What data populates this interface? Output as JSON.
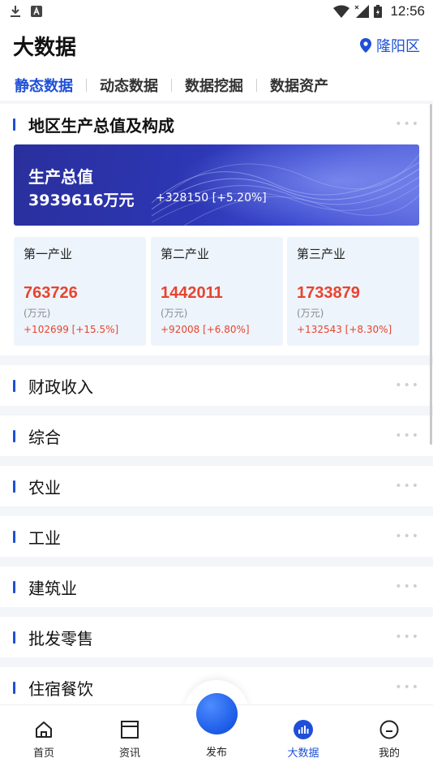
{
  "status_bar": {
    "time": "12:56"
  },
  "header": {
    "title": "大数据",
    "location": "隆阳区"
  },
  "tabs": [
    {
      "label": "静态数据",
      "active": true
    },
    {
      "label": "动态数据",
      "active": false
    },
    {
      "label": "数据挖掘",
      "active": false
    },
    {
      "label": "数据资产",
      "active": false
    }
  ],
  "gdp_section": {
    "title": "地区生产总值及构成",
    "banner": {
      "label": "生产总值",
      "value": "3939616万元",
      "change": "+328150 [+5.20%]"
    },
    "industries": [
      {
        "name": "第一产业",
        "value": "763726",
        "unit": "(万元)",
        "change": "+102699 [+15.5%]"
      },
      {
        "name": "第二产业",
        "value": "1442011",
        "unit": "(万元)",
        "change": "+92008 [+6.80%]"
      },
      {
        "name": "第三产业",
        "value": "1733879",
        "unit": "(万元)",
        "change": "+132543 [+8.30%]"
      }
    ]
  },
  "sections": [
    "财政收入",
    "综合",
    "农业",
    "工业",
    "建筑业",
    "批发零售",
    "住宿餐饮"
  ],
  "more_glyph": "•••",
  "bottom_nav": [
    {
      "label": "首页",
      "icon": "home-icon"
    },
    {
      "label": "资讯",
      "icon": "news-icon"
    },
    {
      "label": "发布",
      "icon": "publish-icon"
    },
    {
      "label": "大数据",
      "icon": "bigdata-icon",
      "active": true
    },
    {
      "label": "我的",
      "icon": "profile-icon"
    }
  ],
  "colors": {
    "accent": "#1e4fd6",
    "rise": "#e8432e",
    "card_bg": "#eef4fb",
    "band": "#f3f5f9"
  }
}
